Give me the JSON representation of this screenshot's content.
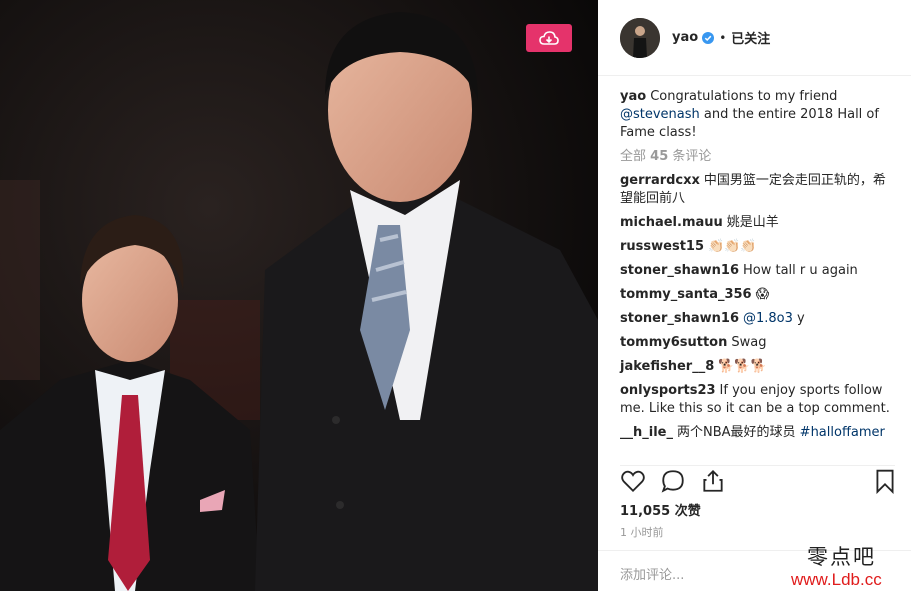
{
  "post": {
    "username": "yao",
    "follow_label": "已关注",
    "separator": "•",
    "caption_user": "yao",
    "caption_text_1": "Congratulations to my friend",
    "caption_mention": "@stevenash",
    "caption_text_2": "and the entire 2018 Hall of Fame class!",
    "all_comments_prefix": "全部",
    "all_comments_count": "45",
    "all_comments_suffix": "条评论",
    "likes": "11,055 次赞",
    "time": "1 小时前",
    "add_comment_placeholder": "添加评论..."
  },
  "comments": [
    {
      "user": "gerrardcxx",
      "text": "中国男篮一定会走回正轨的，希望能回前八"
    },
    {
      "user": "michael.mauu",
      "text": "姚是山羊"
    },
    {
      "user": "russwest15",
      "text": "👏🏻👏🏻👏🏻"
    },
    {
      "user": "stoner_shawn16",
      "text": "How tall r u again"
    },
    {
      "user": "tommy_santa_356",
      "text": "😱"
    },
    {
      "user": "stoner_shawn16",
      "link": "@1.8o3",
      "text": " y"
    },
    {
      "user": "tommy6sutton",
      "text": "Swag"
    },
    {
      "user": "jakefisher__8",
      "text": "🐕🐕🐕"
    },
    {
      "user": "onlysports23",
      "text": "If you enjoy sports follow me. Like this so it can be a top comment."
    },
    {
      "user": "__h_ile_",
      "text": "两个NBA最好的球员",
      "hashtag": "#halloffamer"
    }
  ],
  "watermark": {
    "line1": "零点吧",
    "line2": "www.Ldb.cc"
  },
  "colors": {
    "accent": "#e5336b",
    "verified": "#3897f0",
    "link": "#003569",
    "muted": "#999999"
  },
  "icons": [
    "cloud-save-icon",
    "verified-badge-icon",
    "heart-icon",
    "comment-icon",
    "share-icon",
    "bookmark-icon"
  ]
}
